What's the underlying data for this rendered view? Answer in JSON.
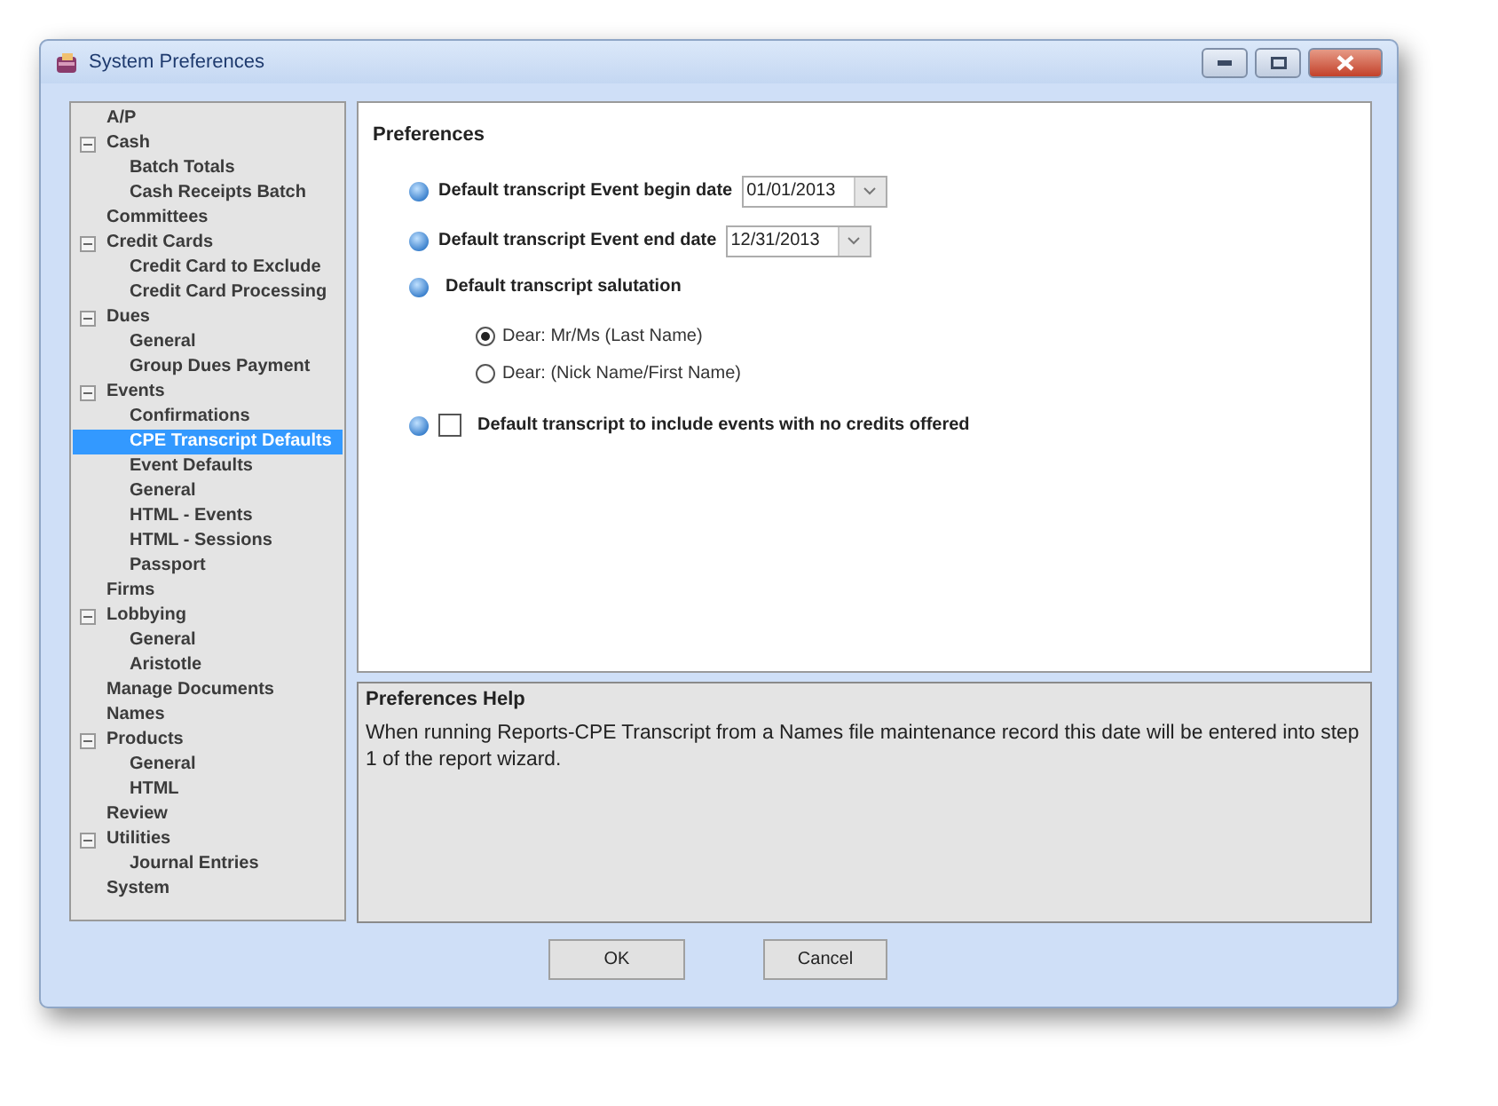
{
  "window": {
    "title": "System Preferences"
  },
  "tree": [
    {
      "label": "A/P",
      "selected": false
    },
    {
      "label": "Cash",
      "selected": false,
      "expanded": true,
      "children": [
        {
          "label": "Batch Totals",
          "selected": false
        },
        {
          "label": "Cash Receipts Batch",
          "selected": false
        }
      ]
    },
    {
      "label": "Committees",
      "selected": false
    },
    {
      "label": "Credit Cards",
      "selected": false,
      "expanded": true,
      "children": [
        {
          "label": "Credit Card to Exclude",
          "selected": false
        },
        {
          "label": "Credit Card Processing",
          "selected": false
        }
      ]
    },
    {
      "label": "Dues",
      "selected": false,
      "expanded": true,
      "children": [
        {
          "label": "General",
          "selected": false
        },
        {
          "label": "Group Dues Payment",
          "selected": false
        }
      ]
    },
    {
      "label": "Events",
      "selected": false,
      "expanded": true,
      "children": [
        {
          "label": "Confirmations",
          "selected": false
        },
        {
          "label": "CPE Transcript Defaults",
          "selected": true
        },
        {
          "label": "Event Defaults",
          "selected": false
        },
        {
          "label": "General",
          "selected": false
        },
        {
          "label": "HTML - Events",
          "selected": false
        },
        {
          "label": "HTML - Sessions",
          "selected": false
        },
        {
          "label": "Passport",
          "selected": false
        }
      ]
    },
    {
      "label": "Firms",
      "selected": false
    },
    {
      "label": "Lobbying",
      "selected": false,
      "expanded": true,
      "children": [
        {
          "label": "General",
          "selected": false
        },
        {
          "label": "Aristotle",
          "selected": false
        }
      ]
    },
    {
      "label": "Manage Documents",
      "selected": false
    },
    {
      "label": "Names",
      "selected": false
    },
    {
      "label": "Products",
      "selected": false,
      "expanded": true,
      "children": [
        {
          "label": "General",
          "selected": false
        },
        {
          "label": "HTML",
          "selected": false
        }
      ]
    },
    {
      "label": "Review",
      "selected": false
    },
    {
      "label": "Utilities",
      "selected": false,
      "expanded": true,
      "children": [
        {
          "label": "Journal Entries",
          "selected": false
        }
      ]
    },
    {
      "label": "System",
      "selected": false
    }
  ],
  "preferences": {
    "title": "Preferences",
    "settings": [
      {
        "kind": "date",
        "label": "Default transcript Event begin date",
        "value": "01/01/2013"
      },
      {
        "kind": "date",
        "label": "Default transcript Event end date",
        "value": "12/31/2013"
      },
      {
        "kind": "radio",
        "label": "Default transcript salutation",
        "options": [
          {
            "label": "Dear: Mr/Ms (Last Name)",
            "selected": true
          },
          {
            "label": "Dear: (Nick Name/First Name)",
            "selected": false
          }
        ]
      },
      {
        "kind": "checkbox",
        "label": "Default transcript to include events with no credits offered",
        "checked": false
      }
    ]
  },
  "help": {
    "title": "Preferences Help",
    "text": "When running Reports-CPE Transcript from a Names file maintenance record this date will be entered into step 1 of the report wizard."
  },
  "buttons": [
    "OK",
    "Cancel"
  ]
}
